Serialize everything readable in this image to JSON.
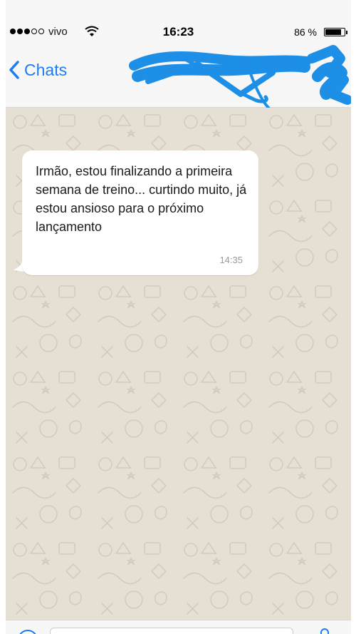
{
  "status_bar": {
    "carrier": "vivo",
    "time": "16:23",
    "battery_percent": "86 %",
    "battery_level": 0.86,
    "signal_bars_filled": 3,
    "signal_bars_total": 5
  },
  "nav": {
    "back_label": "Chats",
    "contact_name_redacted": true
  },
  "conversation": {
    "messages": [
      {
        "direction": "incoming",
        "text": "Irmão, estou finalizando a primeira semana de treino... curtindo muito, já estou ansioso para o próximo lançamento",
        "time": "14:35"
      }
    ]
  },
  "colors": {
    "accent": "#1d7cf0",
    "redaction": "#1e8fe6",
    "chat_background": "#e6dfd3",
    "bubble": "#ffffff"
  },
  "icons": {
    "back": "chevron-left-icon",
    "wifi": "wifi-icon",
    "battery": "battery-icon",
    "attach": "attach-icon",
    "mic": "microphone-icon"
  }
}
